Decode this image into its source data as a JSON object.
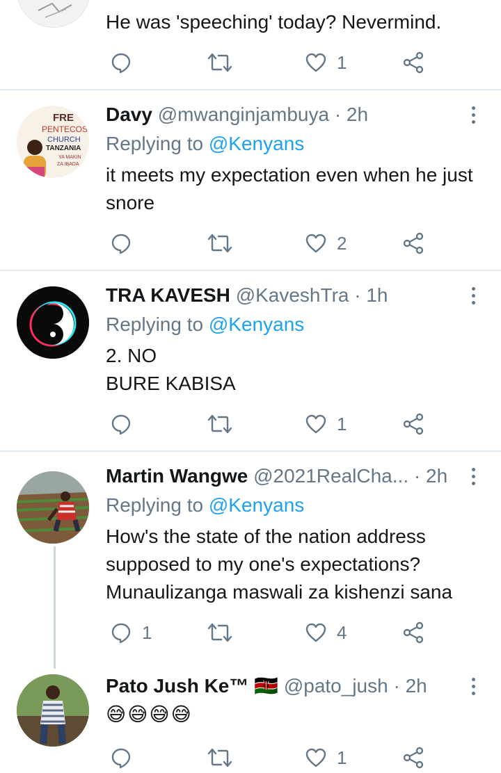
{
  "tweets": [
    {
      "text": "He was 'speeching' today? Nevermind.",
      "actions": {
        "replies": "",
        "likes": "1"
      }
    },
    {
      "name": "Davy",
      "handle": "@mwanginjambuya",
      "time": "· 2h",
      "replying_prefix": "Replying to",
      "replying_to": "@Kenyans",
      "text": "it meets my expectation even when he just snore",
      "actions": {
        "replies": "",
        "likes": "2"
      },
      "avatar_text": [
        "FRE",
        "PENTECOS",
        "CHURCH",
        "TANZANIA",
        "YA MAKIN",
        "ZA IBADA"
      ]
    },
    {
      "name": "TRA KAVESH",
      "handle": "@KaveshTra",
      "time": "· 1h",
      "replying_prefix": "Replying to",
      "replying_to": "@Kenyans",
      "text_line1": "2. NO",
      "text_line2": "BURE KABISA",
      "actions": {
        "replies": "",
        "likes": "1"
      }
    },
    {
      "name": "Martin Wangwe",
      "handle": "@2021RealCha...",
      "time": "· 2h",
      "replying_prefix": "Replying to",
      "replying_to": "@Kenyans",
      "text": "How's the state of the nation address supposed to my one's expectations? Munaulizanga maswali za kishenzi sana",
      "actions": {
        "replies": "1",
        "likes": "4"
      }
    },
    {
      "name": "Pato Jush Ke™",
      "flag": "🇰🇪",
      "handle": "@pato_jush",
      "time": "· 2h",
      "text": "😅😅😅😅",
      "actions": {
        "replies": "",
        "likes": "1"
      }
    }
  ],
  "colors": {
    "link": "#1da1f2",
    "secondary": "#657786",
    "divider": "#e1e8ed",
    "thread_line": "#ccd6dd"
  },
  "icons": [
    "reply-icon",
    "retweet-icon",
    "like-icon",
    "share-icon",
    "more-icon"
  ]
}
